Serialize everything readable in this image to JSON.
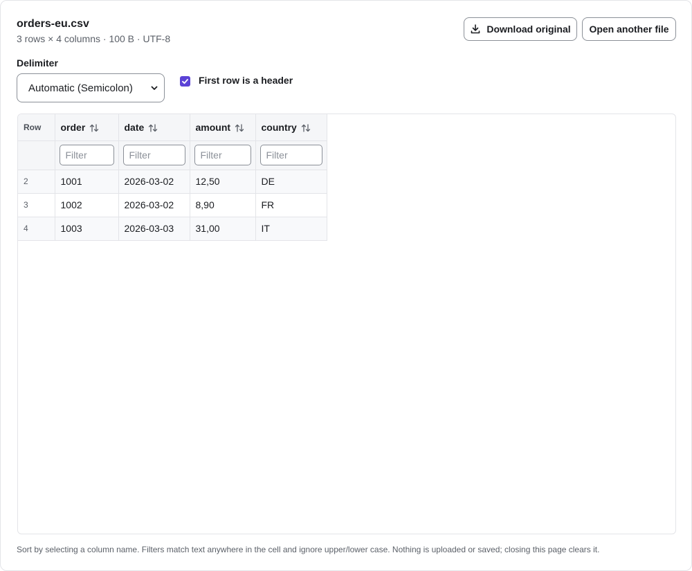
{
  "file": {
    "name": "orders-eu.csv",
    "meta": "3 rows × 4 columns · 100 B · UTF-8"
  },
  "toolbar": {
    "download_label": "Download original",
    "open_label": "Open another file"
  },
  "options": {
    "delimiter_label": "Delimiter",
    "delimiter_value": "Automatic (Semicolon)",
    "header_checkbox_label": "First row is a header",
    "header_checked": true
  },
  "table": {
    "row_header": "Row",
    "filter_placeholder": "Filter",
    "columns": [
      "order",
      "date",
      "amount",
      "country"
    ],
    "rows": [
      {
        "num": "2",
        "cells": [
          "1001",
          "2026-03-02",
          "12,50",
          "DE"
        ]
      },
      {
        "num": "3",
        "cells": [
          "1002",
          "2026-03-02",
          "8,90",
          "FR"
        ]
      },
      {
        "num": "4",
        "cells": [
          "1003",
          "2026-03-03",
          "31,00",
          "IT"
        ]
      }
    ]
  },
  "footer": {
    "note": "Sort by selecting a column name. Filters match text anywhere in the cell and ignore upper/lower case. Nothing is uploaded or saved; closing this page clears it."
  },
  "colors": {
    "accent": "#5b43d6",
    "border": "#e3e4e8",
    "header_bg": "#f5f6f8"
  },
  "icons": [
    "download-icon",
    "chevron-down-icon",
    "check-icon",
    "sort-icon"
  ]
}
